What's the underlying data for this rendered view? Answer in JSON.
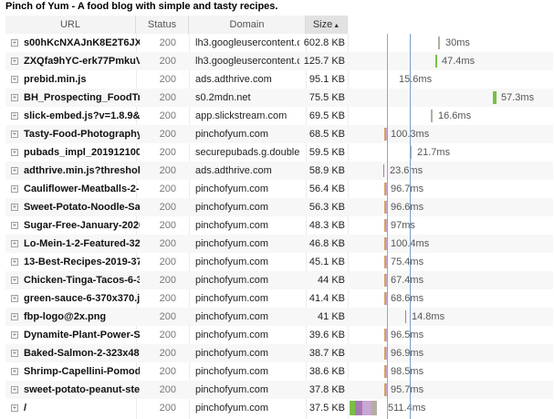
{
  "page": {
    "title": "Pinch of Yum - A food blog with simple and tasty recipes."
  },
  "columns": {
    "url": "URL",
    "status": "Status",
    "domain": "Domain",
    "size": "Size",
    "sort_icon": "sort-ascending-icon"
  },
  "colors": {
    "bar_gray": "#b4aea4",
    "bar_green": "#77c043",
    "bar_purple": "#a679b5",
    "bar_light_purple": "#c9a6d4",
    "bar_tan": "#d7a15a",
    "line_green": "#7ac17a",
    "line_blue": "#7a9ec9"
  },
  "waterfall": {
    "lines": [
      {
        "name": "green",
        "color": "#7ac17a"
      },
      {
        "name": "blue",
        "color": "#7a9ec9"
      }
    ]
  },
  "rows": [
    {
      "url": "s00hKcNXAJnK8E2T6JX",
      "status": "200",
      "domain": "lh3.googleusercontent.c",
      "size": "602.8 KB",
      "time": "30ms",
      "kind": "gray"
    },
    {
      "url": "ZXQfa9hYC-erk77PmkuV",
      "status": "200",
      "domain": "lh3.googleusercontent.c",
      "size": "125.7 KB",
      "time": "47.4ms",
      "kind": "green"
    },
    {
      "url": "prebid.min.js",
      "status": "200",
      "domain": "ads.adthrive.com",
      "size": "95.1 KB",
      "time": "15.6ms",
      "kind": "none"
    },
    {
      "url": "BH_Prospecting_FoodTr",
      "status": "200",
      "domain": "s0.2mdn.net",
      "size": "75.5 KB",
      "time": "57.3ms",
      "kind": "green"
    },
    {
      "url": "slick-embed.js?v=1.8.9&",
      "status": "200",
      "domain": "app.slickstream.com",
      "size": "69.5 KB",
      "time": "16.6ms",
      "kind": "gray"
    },
    {
      "url": "Tasty-Food-Photography",
      "status": "200",
      "domain": "pinchofyum.com",
      "size": "68.5 KB",
      "time": "100.3ms",
      "kind": "multi"
    },
    {
      "url": "pubads_impl_201912100",
      "status": "200",
      "domain": "securepubads.g.double",
      "size": "59.5 KB",
      "time": "21.7ms",
      "kind": "gray"
    },
    {
      "url": "adthrive.min.js?threshol",
      "status": "200",
      "domain": "ads.adthrive.com",
      "size": "58.9 KB",
      "time": "23.6ms",
      "kind": "purple"
    },
    {
      "url": "Cauliflower-Meatballs-2-",
      "status": "200",
      "domain": "pinchofyum.com",
      "size": "56.4 KB",
      "time": "96.7ms",
      "kind": "multi"
    },
    {
      "url": "Sweet-Potato-Noodle-Sa",
      "status": "200",
      "domain": "pinchofyum.com",
      "size": "56.3 KB",
      "time": "96.6ms",
      "kind": "multi"
    },
    {
      "url": "Sugar-Free-January-2020",
      "status": "200",
      "domain": "pinchofyum.com",
      "size": "48.3 KB",
      "time": "97ms",
      "kind": "multi"
    },
    {
      "url": "Lo-Mein-1-2-Featured-32",
      "status": "200",
      "domain": "pinchofyum.com",
      "size": "46.8 KB",
      "time": "100.4ms",
      "kind": "multi"
    },
    {
      "url": "13-Best-Recipes-2019-37",
      "status": "200",
      "domain": "pinchofyum.com",
      "size": "45.1 KB",
      "time": "75.4ms",
      "kind": "multi"
    },
    {
      "url": "Chicken-Tinga-Tacos-6-3",
      "status": "200",
      "domain": "pinchofyum.com",
      "size": "44 KB",
      "time": "67.4ms",
      "kind": "multi"
    },
    {
      "url": "green-sauce-6-370x370.j",
      "status": "200",
      "domain": "pinchofyum.com",
      "size": "41.4 KB",
      "time": "68.6ms",
      "kind": "multi"
    },
    {
      "url": "fbp-logo@2x.png",
      "status": "200",
      "domain": "pinchofyum.com",
      "size": "41 KB",
      "time": "14.8ms",
      "kind": "purple"
    },
    {
      "url": "Dynamite-Plant-Power-S",
      "status": "200",
      "domain": "pinchofyum.com",
      "size": "39.6 KB",
      "time": "96.5ms",
      "kind": "multi"
    },
    {
      "url": "Baked-Salmon-2-323x48",
      "status": "200",
      "domain": "pinchofyum.com",
      "size": "38.7 KB",
      "time": "96.9ms",
      "kind": "multi"
    },
    {
      "url": "Shrimp-Capellini-Pomod",
      "status": "200",
      "domain": "pinchofyum.com",
      "size": "38.6 KB",
      "time": "98.5ms",
      "kind": "multi"
    },
    {
      "url": "sweet-potato-peanut-ste",
      "status": "200",
      "domain": "pinchofyum.com",
      "size": "37.8 KB",
      "time": "95.7ms",
      "kind": "multi"
    },
    {
      "url": "/",
      "status": "200",
      "domain": "pinchofyum.com",
      "size": "37.5 KB",
      "time": "511.4ms",
      "kind": "doc"
    }
  ]
}
